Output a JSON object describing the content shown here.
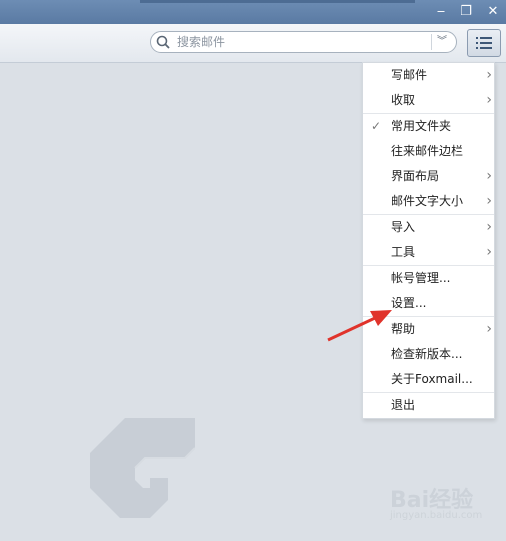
{
  "window": {
    "minimize_glyph": "‒",
    "restore_glyph": "❐",
    "close_glyph": "✕"
  },
  "search": {
    "placeholder": "搜索邮件",
    "value": ""
  },
  "menu": {
    "groups": [
      [
        {
          "label": "写邮件",
          "submenu": true
        },
        {
          "label": "收取",
          "submenu": true
        }
      ],
      [
        {
          "label": "常用文件夹",
          "checked": true
        },
        {
          "label": "往来邮件边栏"
        },
        {
          "label": "界面布局",
          "submenu": true
        },
        {
          "label": "邮件文字大小",
          "submenu": true
        }
      ],
      [
        {
          "label": "导入",
          "submenu": true
        },
        {
          "label": "工具",
          "submenu": true
        }
      ],
      [
        {
          "label": "帐号管理..."
        },
        {
          "label": "设置..."
        }
      ],
      [
        {
          "label": "帮助",
          "submenu": true
        },
        {
          "label": "检查新版本..."
        },
        {
          "label": "关于Foxmail..."
        }
      ],
      [
        {
          "label": "退出"
        }
      ]
    ]
  },
  "watermark": {
    "brand": "Bai经验",
    "url": "jingyan.baidu.com"
  },
  "colors": {
    "titlebar": "#5f80a8",
    "annotation_arrow": "#e0332b"
  }
}
